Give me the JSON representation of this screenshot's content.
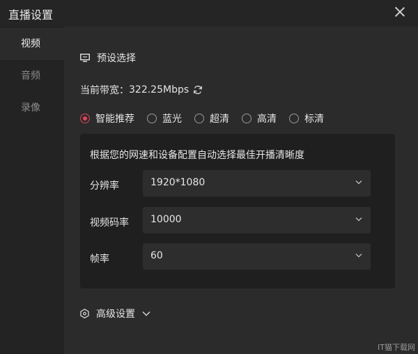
{
  "window": {
    "title": "直播设置"
  },
  "sidebar": {
    "items": [
      {
        "label": "视频",
        "active": true
      },
      {
        "label": "音频",
        "active": false
      },
      {
        "label": "录像",
        "active": false
      }
    ]
  },
  "preset": {
    "section_title": "预设选择",
    "bandwidth_label": "当前带宽：",
    "bandwidth_value": "322.25Mbps",
    "options": [
      {
        "label": "智能推荐",
        "checked": true
      },
      {
        "label": "蓝光",
        "checked": false
      },
      {
        "label": "超清",
        "checked": false
      },
      {
        "label": "高清",
        "checked": false
      },
      {
        "label": "标清",
        "checked": false
      }
    ]
  },
  "panel": {
    "description": "根据您的网速和设备配置自动选择最佳开播清晰度",
    "resolution": {
      "label": "分辨率",
      "value": "1920*1080"
    },
    "bitrate": {
      "label": "视频码率",
      "value": "10000"
    },
    "framerate": {
      "label": "帧率",
      "value": "60"
    }
  },
  "advanced": {
    "label": "高级设置"
  },
  "watermark": "IT猫下载网",
  "colors": {
    "accent": "#e0455a",
    "background": "#2b2b2b",
    "panel": "#1f1f1f"
  },
  "icons": {
    "close": "close-icon",
    "preset": "monitor-icon",
    "refresh": "refresh-icon",
    "advanced": "hexagon-icon",
    "dropdown": "chevron-down-icon"
  }
}
